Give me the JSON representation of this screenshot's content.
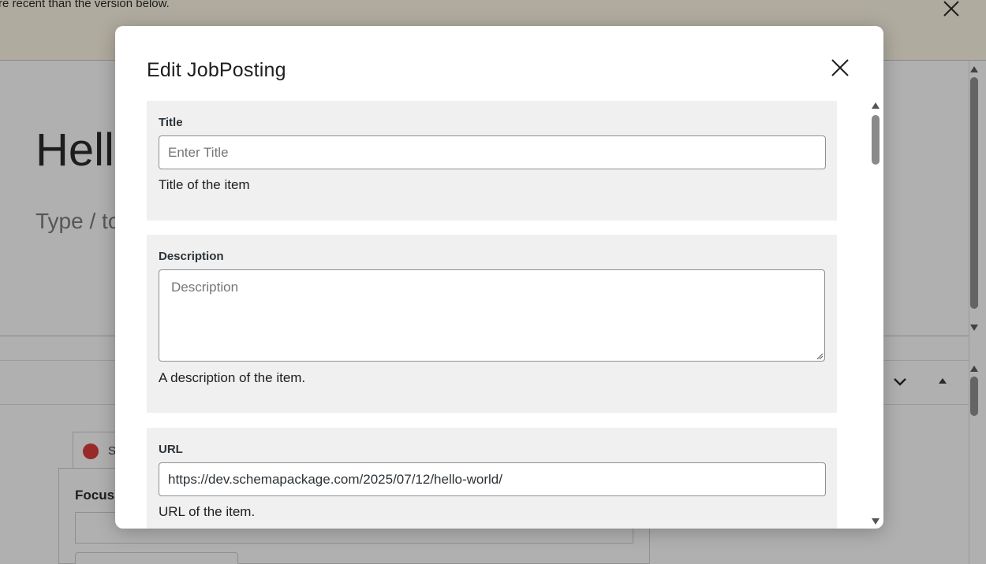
{
  "background": {
    "notice_text": "re recent than the version below.",
    "post_title": "Hell",
    "post_placeholder": "Type / to",
    "seo_tab_letter": "S",
    "focus_label": "Focus"
  },
  "modal": {
    "title": "Edit JobPosting",
    "fields": [
      {
        "label": "Title",
        "placeholder": "Enter Title",
        "value": "",
        "help": "Title of the item"
      },
      {
        "label": "Description",
        "placeholder": "Description",
        "value": "",
        "help": "A description of the item."
      },
      {
        "label": "URL",
        "placeholder": "",
        "value": "https://dev.schemapackage.com/2025/07/12/hello-world/",
        "help": "URL of the item."
      }
    ]
  },
  "colors": {
    "accent": "#3858e9",
    "error": "#dc3232",
    "field_bg": "#f0f0f0"
  },
  "icons": [
    "close-icon",
    "chevron-down-icon",
    "caret-up-icon",
    "sad-face-icon",
    "resize-grip-icon"
  ]
}
